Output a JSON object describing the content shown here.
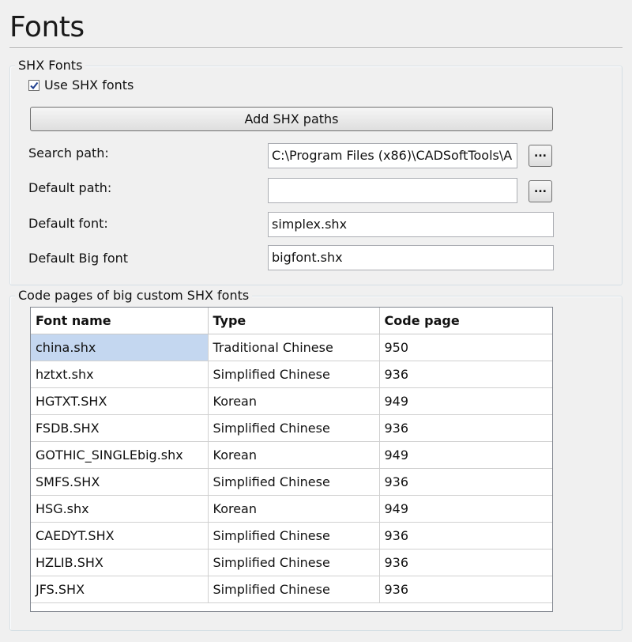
{
  "page": {
    "title": "Fonts"
  },
  "shx_group": {
    "legend": "SHX Fonts",
    "use_shx_label": "Use SHX fonts",
    "use_shx_checked": true,
    "add_paths_label": "Add SHX paths",
    "search_path_label": "Search path:",
    "search_path_value": "C:\\Program Files (x86)\\CADSoftTools\\A",
    "default_path_label": "Default path:",
    "default_path_value": "",
    "default_font_label": "Default font:",
    "default_font_value": "simplex.shx",
    "default_big_font_label": "Default Big font",
    "default_big_font_value": "bigfont.shx",
    "browse_label": "..."
  },
  "codepages_group": {
    "legend": "Code pages of big custom SHX fonts",
    "columns": [
      "Font name",
      "Type",
      "Code page"
    ],
    "rows": [
      [
        "china.shx",
        "Traditional Chinese",
        "950"
      ],
      [
        "hztxt.shx",
        "Simplified Chinese",
        "936"
      ],
      [
        "HGTXT.SHX",
        "Korean",
        "949"
      ],
      [
        "FSDB.SHX",
        "Simplified Chinese",
        "936"
      ],
      [
        "GOTHIC_SINGLEbig.shx",
        "Korean",
        "949"
      ],
      [
        "SMFS.SHX",
        "Simplified Chinese",
        "936"
      ],
      [
        "HSG.shx",
        "Korean",
        "949"
      ],
      [
        "CAEDYT.SHX",
        "Simplified Chinese",
        "936"
      ],
      [
        "HZLIB.SHX",
        "Simplified Chinese",
        "936"
      ],
      [
        "JFS.SHX",
        "Simplified Chinese",
        "936"
      ]
    ],
    "selected_row": 0
  },
  "colors": {
    "selection": "#c4d7f0",
    "background": "#f0f0f0"
  }
}
